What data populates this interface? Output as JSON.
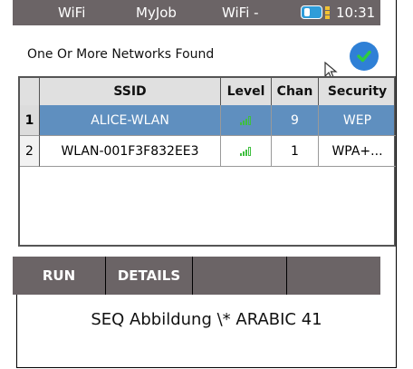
{
  "statusbar": {
    "item1": "WiFi",
    "item2": "MyJob",
    "item3": "WiFi -",
    "time": "10:31"
  },
  "header": {
    "title": "One Or More Networks Found"
  },
  "table": {
    "columns": [
      "SSID",
      "Level",
      "Chan",
      "Security"
    ],
    "rows": [
      {
        "index": "1",
        "ssid": "ALICE-WLAN",
        "chan": "9",
        "security": "WEP",
        "selected": true
      },
      {
        "index": "2",
        "ssid": "WLAN-001F3F832EE3",
        "chan": "1",
        "security": "WPA+...",
        "selected": false
      }
    ]
  },
  "toolbar": {
    "run_label": "RUN",
    "details_label": "DETAILS",
    "btn3_label": "",
    "btn4_label": ""
  },
  "caption": "SEQ Abbildung \\* ARABIC 41",
  "colors": {
    "bar": "#6b6466",
    "selected_row": "#5f8fbf",
    "accent_blue": "#2f80d6",
    "signal_green": "#3fbf3f"
  }
}
